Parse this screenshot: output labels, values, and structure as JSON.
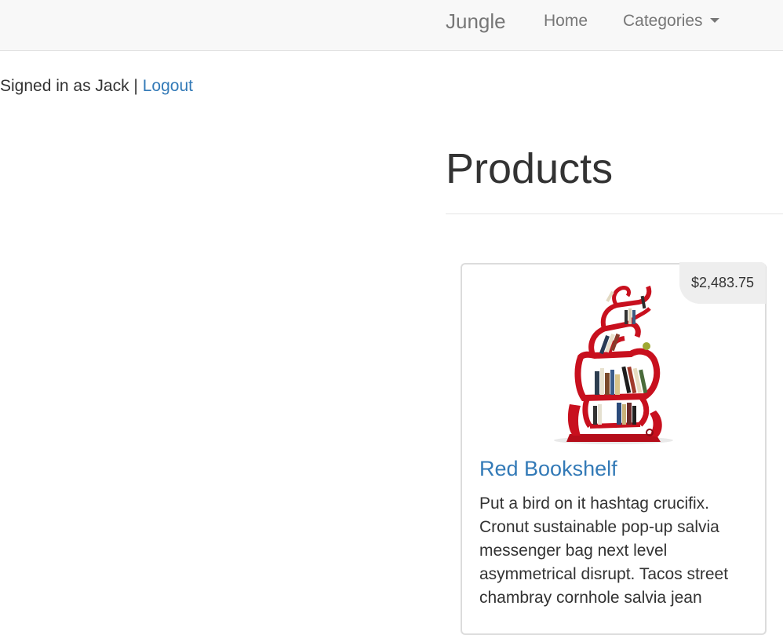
{
  "navbar": {
    "brand": "Jungle",
    "home_label": "Home",
    "categories_label": "Categories"
  },
  "session": {
    "signed_in_text": "Signed in as Jack | ",
    "logout_label": "Logout"
  },
  "main": {
    "title": "Products"
  },
  "product": {
    "name": "Red Bookshelf",
    "price": "$2,483.75",
    "description": "Put a bird on it hashtag crucifix. Cronut sustainable pop-up salvia messenger bag next level asymmetrical disrupt. Tacos street chambray cornhole salvia jean",
    "image_icon": "red-bookshelf-image",
    "colors": {
      "shelf": "#c8101e",
      "link": "#337ab7"
    }
  }
}
